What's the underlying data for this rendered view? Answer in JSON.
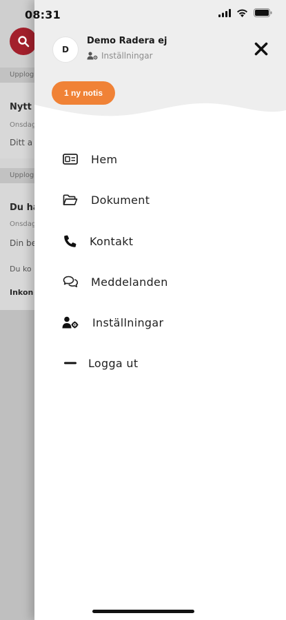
{
  "status_bar": {
    "time": "08:31"
  },
  "background": {
    "strip1": "Upplog",
    "card1_title": "Nytt",
    "card1_date": "Onsdag",
    "card1_body": "Ditt a",
    "strip2": "Upplog",
    "card2_title": "Du ha",
    "card2_date": "Onsdag",
    "card2_body": "Din be",
    "card2_body2": "Du ko",
    "card2_body3": "Inkon"
  },
  "drawer": {
    "user": {
      "avatar_initial": "D",
      "name": "Demo Radera ej",
      "settings_label": "Inställningar"
    },
    "notification_button": "1 ny notis",
    "menu": [
      {
        "label": "Hem",
        "icon": "id-card-icon"
      },
      {
        "label": "Dokument",
        "icon": "folder-open-icon"
      },
      {
        "label": "Kontakt",
        "icon": "phone-icon"
      },
      {
        "label": "Meddelanden",
        "icon": "chat-bubbles-icon"
      },
      {
        "label": "Inställningar",
        "icon": "user-gear-icon"
      },
      {
        "label": "Logga ut",
        "icon": "minus-icon"
      }
    ]
  },
  "colors": {
    "accent_orange": "#f08236",
    "search_red": "#a3202c",
    "header_gray": "#eeeeee"
  }
}
